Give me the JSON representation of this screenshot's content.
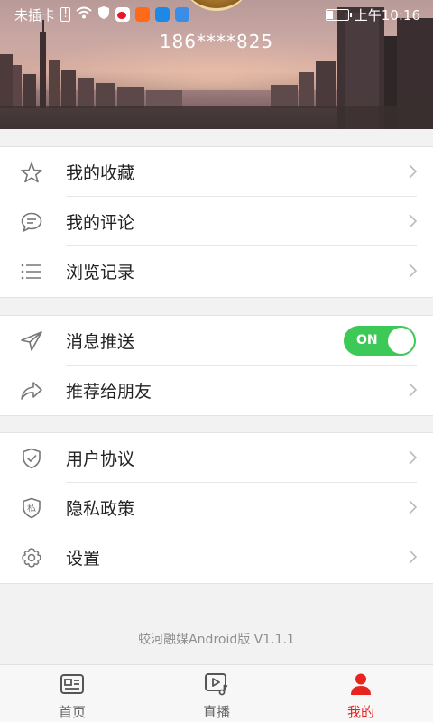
{
  "status_bar": {
    "carrier": "未插卡",
    "time": "上午10:16"
  },
  "profile": {
    "phone": "186****825"
  },
  "menu_group_1": [
    {
      "label": "我的收藏",
      "icon": "star-icon"
    },
    {
      "label": "我的评论",
      "icon": "comment-icon"
    },
    {
      "label": "浏览记录",
      "icon": "list-icon"
    }
  ],
  "menu_group_2": [
    {
      "label": "消息推送",
      "icon": "send-icon",
      "toggle": "ON"
    },
    {
      "label": "推荐给朋友",
      "icon": "share-icon"
    }
  ],
  "menu_group_3": [
    {
      "label": "用户协议",
      "icon": "shield-check-icon"
    },
    {
      "label": "隐私政策",
      "icon": "privacy-shield-icon",
      "icon_text": "私"
    },
    {
      "label": "设置",
      "icon": "gear-icon"
    }
  ],
  "footer": {
    "version": "蛟河融媒Android版 V1.1.1"
  },
  "tabs": [
    {
      "label": "首页",
      "icon": "news-icon",
      "active": false
    },
    {
      "label": "直播",
      "icon": "video-music-icon",
      "active": false
    },
    {
      "label": "我的",
      "icon": "person-icon",
      "active": true
    }
  ],
  "colors": {
    "accent": "#e8241f",
    "toggle_on": "#3cc957"
  }
}
